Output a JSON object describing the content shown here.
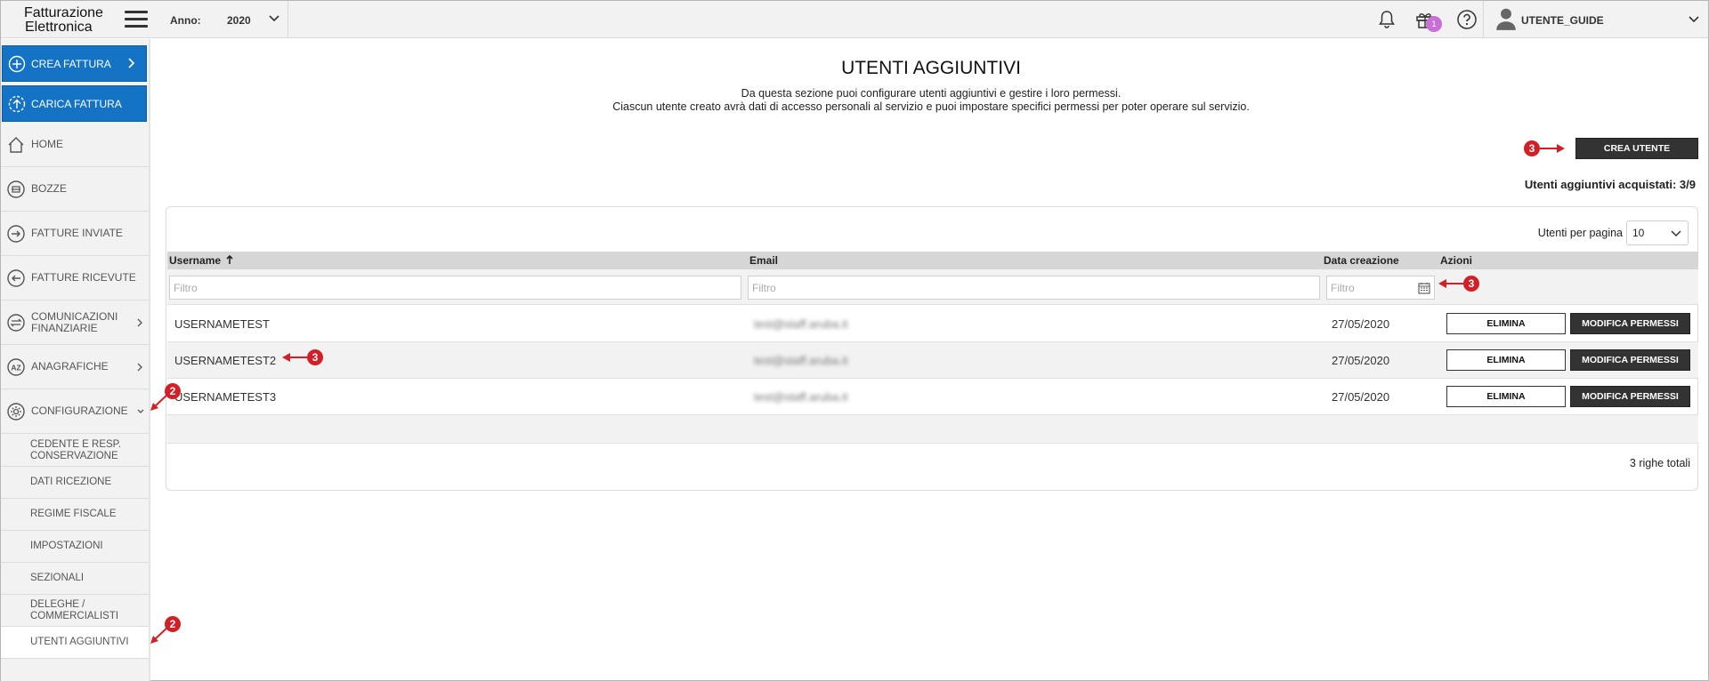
{
  "topbar": {
    "logo_line1": "Fatturazione",
    "logo_line2": "Elettronica",
    "year_label": "Anno:",
    "year_value": "2020",
    "notification_badge": "1",
    "user_name": "UTENTE_GUIDE"
  },
  "sidebar": {
    "create_invoice": "CREA FATTURA",
    "upload_invoice": "CARICA FATTURA",
    "items": [
      {
        "label": "HOME",
        "icon": "home-icon"
      },
      {
        "label": "BOZZE",
        "icon": "drafts-icon"
      },
      {
        "label": "FATTURE INVIATE",
        "icon": "sent-icon"
      },
      {
        "label": "FATTURE RICEVUTE",
        "icon": "received-icon"
      },
      {
        "label": "COMUNICAZIONI FINANZIARIE",
        "icon": "exchange-icon"
      },
      {
        "label": "ANAGRAFICHE",
        "icon": "az-icon"
      },
      {
        "label": "CONFIGURAZIONE",
        "icon": "gear-icon"
      }
    ],
    "sub_items": [
      "CEDENTE E RESP. CONSERVAZIONE",
      "DATI RICEZIONE",
      "REGIME FISCALE",
      "IMPOSTAZIONI",
      "SEZIONALI",
      "DELEGHE / COMMERCIALISTI",
      "UTENTI AGGIUNTIVI"
    ]
  },
  "main": {
    "title": "UTENTI AGGIUNTIVI",
    "desc_line1": "Da questa sezione puoi configurare utenti aggiuntivi e gestire i loro permessi.",
    "desc_line2": "Ciascun utente creato avrà dati di accesso personali al servizio e puoi impostare specifici permessi per poter operare sul servizio.",
    "create_user_button": "CREA UTENTE",
    "purchased_label": "Utenti aggiuntivi acquistati: 3/9",
    "per_page_label": "Utenti per pagina",
    "per_page_value": "10",
    "columns": [
      "Username",
      "Email",
      "Data creazione",
      "Azioni"
    ],
    "filter_placeholder": "Filtro",
    "rows": [
      {
        "username": "USERNAMETEST",
        "email": "test@staff.aruba.it",
        "date": "27/05/2020"
      },
      {
        "username": "USERNAMETEST2",
        "email": "test@staff.aruba.it",
        "date": "27/05/2020"
      },
      {
        "username": "USERNAMETEST3",
        "email": "test@staff.aruba.it",
        "date": "27/05/2020"
      }
    ],
    "delete_label": "ELIMINA",
    "edit_permissions_label": "MODIFICA PERMESSI",
    "total_rows": "3 righe totali"
  },
  "annotations": [
    "2",
    "2",
    "3",
    "3",
    "3"
  ],
  "colors": {
    "primary_blue": "#1573c6",
    "dark_button": "#333333",
    "annotation_red": "#d32027",
    "badge_purple": "#c86fd8"
  }
}
